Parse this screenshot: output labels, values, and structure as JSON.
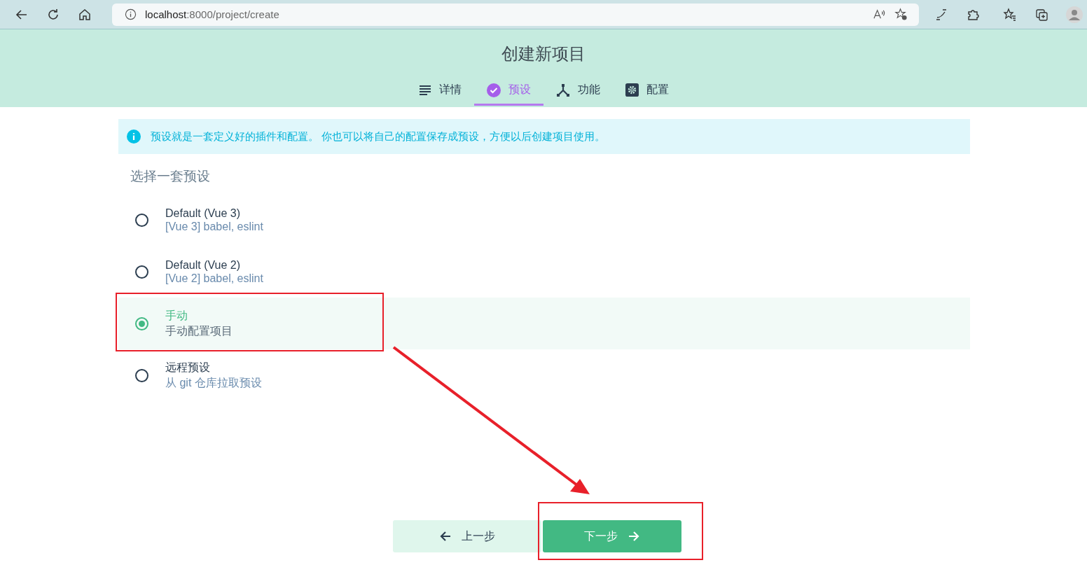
{
  "browser": {
    "url_host": "localhost",
    "url_path": ":8000/project/create"
  },
  "header": {
    "title": "创建新项目"
  },
  "tabs": [
    {
      "label": "详情",
      "kind": "list",
      "selected": false
    },
    {
      "label": "预设",
      "kind": "check",
      "selected": true
    },
    {
      "label": "功能",
      "kind": "fork",
      "selected": false
    },
    {
      "label": "配置",
      "kind": "gear",
      "selected": false
    }
  ],
  "info": {
    "text": "预设就是一套定义好的插件和配置。 你也可以将自己的配置保存成预设，方便以后创建项目使用。"
  },
  "section_title": "选择一套预设",
  "presets": [
    {
      "name": "Default (Vue 3)",
      "description": "[Vue 3] babel, eslint",
      "selected": false
    },
    {
      "name": "Default (Vue 2)",
      "description": "[Vue 2] babel, eslint",
      "selected": false
    },
    {
      "name": "手动",
      "description": "手动配置项目",
      "selected": true
    },
    {
      "name": "远程预设",
      "description": "从 git 仓库拉取预设",
      "selected": false
    }
  ],
  "buttons": {
    "previous": "上一步",
    "next": "下一步"
  }
}
